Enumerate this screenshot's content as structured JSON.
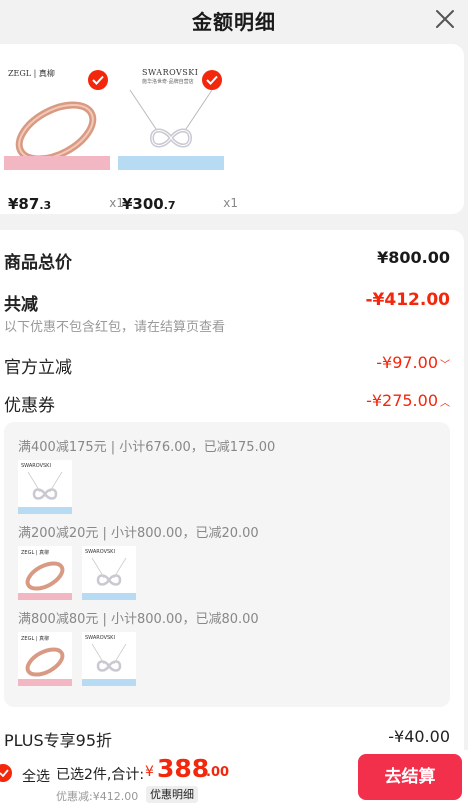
{
  "header": {
    "title": "金额明细"
  },
  "products": [
    {
      "brand": "ZEGL | 真柳",
      "price_int": "¥87",
      "price_dec": ".3",
      "qty": "x1"
    },
    {
      "brand": "SWAROVSKI",
      "brand_sub": "施华洛世奇·品牌自营店",
      "price_int": "¥300",
      "price_dec": ".7",
      "qty": "x1"
    }
  ],
  "summary": {
    "goods_total_label": "商品总价",
    "goods_total_value": "¥800.00",
    "reduce_label": "共减",
    "reduce_value": "-¥412.00",
    "reduce_note": "以下优惠不包含红包，请在结算页查看",
    "official_label": "官方立减",
    "official_value": "-¥97.00",
    "coupon_label": "优惠券",
    "coupon_value": "-¥275.00",
    "plus_label": "PLUS专享95折",
    "plus_value": "-¥40.00"
  },
  "coupons": [
    {
      "text": "满400减175元 | 小计676.00，已减175.00"
    },
    {
      "text": "满200减20元 | 小计800.00，已减20.00"
    },
    {
      "text": "满800减80元 | 小计800.00，已减80.00"
    }
  ],
  "footer": {
    "select_all": "全选",
    "selected": "已选2件,合计:",
    "total_symbol": "¥",
    "total_int": "388",
    "total_dec": ".00",
    "discount": "优惠减:¥412.00",
    "detail": "优惠明细",
    "checkout": "去结算"
  },
  "colors": {
    "accent": "#f2270c",
    "checkout": "#f2304b"
  }
}
